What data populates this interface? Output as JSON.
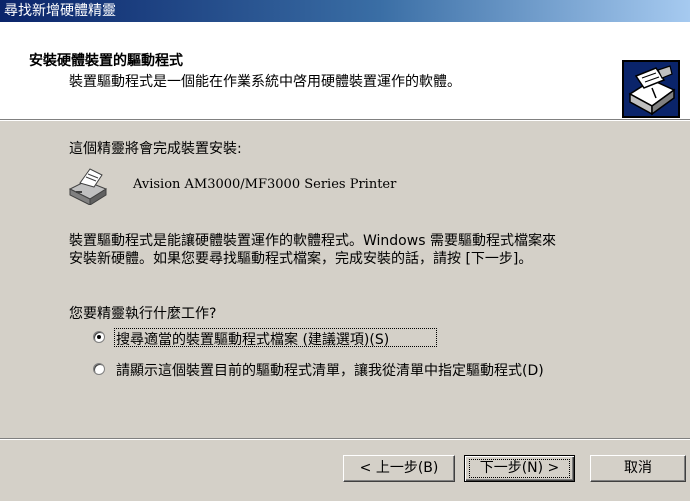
{
  "window": {
    "title": "尋找新增硬體精靈"
  },
  "header": {
    "title": "安裝硬體裝置的驅動程式",
    "subtitle": "裝置驅動程式是一個能在作業系統中啓用硬體裝置運作的軟體。",
    "icon": "hardware-wizard-icon"
  },
  "body": {
    "intro": "這個精靈將會完成裝置安裝:",
    "device": {
      "icon": "printer-icon",
      "name": "Avision AM3000/MF3000 Series Printer"
    },
    "description_line1": "裝置驅動程式是能讓硬體裝置運作的軟體程式。Windows 需要驅動程式檔案來",
    "description_line2": "安裝新硬體。如果您要尋找驅動程式檔案，完成安裝的話，請按 [下一步]。",
    "question": "您要精靈執行什麼工作?",
    "options": [
      {
        "label": "搜尋適當的裝置驅動程式檔案 (建議選項)(S)",
        "selected": true
      },
      {
        "label": "請顯示這個裝置目前的驅動程式清單，讓我從清單中指定驅動程式(D)",
        "selected": false
      }
    ]
  },
  "footer": {
    "back_label": "< 上一步(B)",
    "next_label": "下一步(N) >",
    "cancel_label": "取消"
  }
}
